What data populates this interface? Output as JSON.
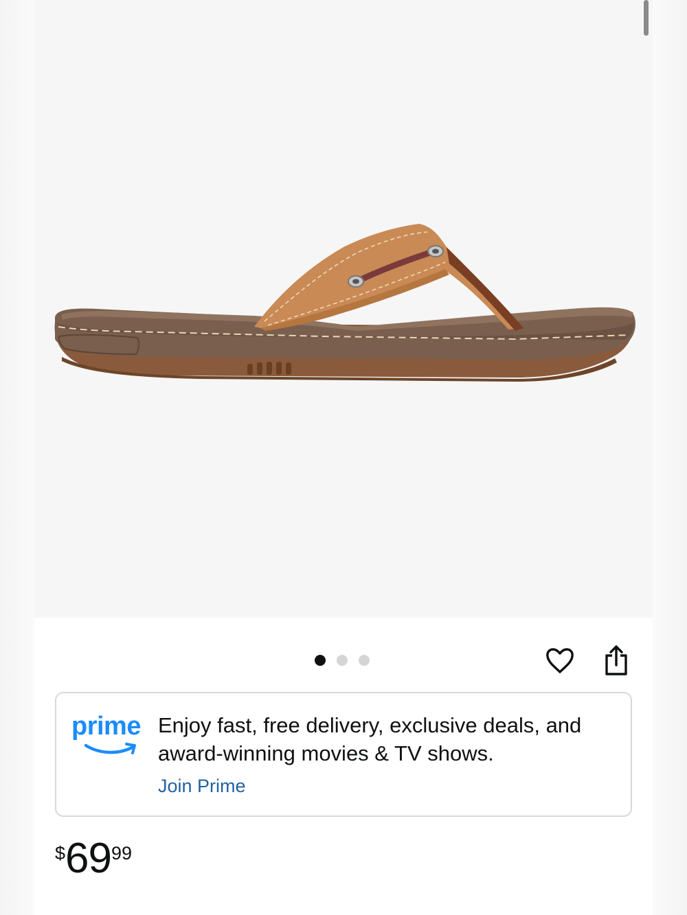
{
  "gallery": {
    "image_alt": "Brown leather thong flip-flop sandal with boat-shoe lacing",
    "dots_total": 3,
    "dots_active": 1
  },
  "actions": {
    "wishlist_icon": "heart-icon",
    "share_icon": "share-icon"
  },
  "prime": {
    "logo_text": "prime",
    "message": "Enjoy fast, free delivery, exclusive deals, and award-winning movies & TV shows.",
    "link_label": "Join Prime",
    "brand_color": "#1a8cff",
    "link_color": "#2162a1"
  },
  "price": {
    "currency": "$",
    "whole": "69",
    "fraction": "99"
  }
}
